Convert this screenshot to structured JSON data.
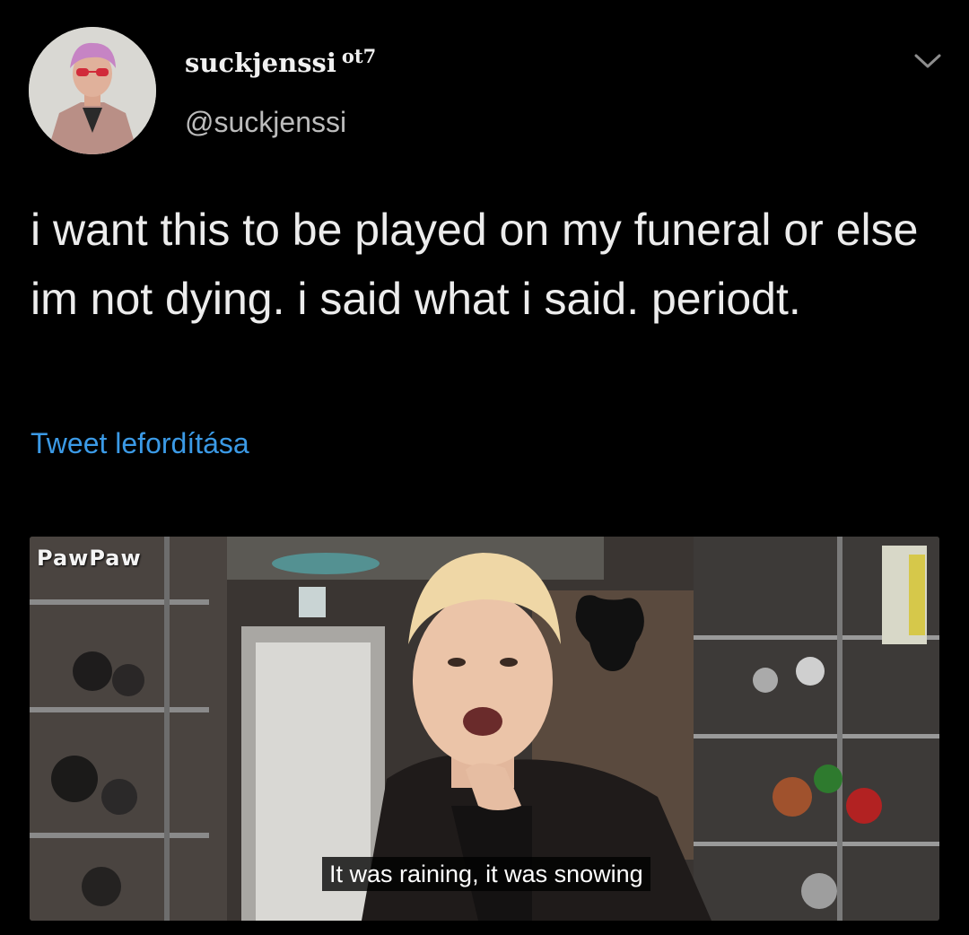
{
  "tweet": {
    "display_name": "suckjenssi",
    "name_suffix": "ot7",
    "handle": "@suckjenssi",
    "text": "i want this to be played on my funeral or else im not dying. i said what i said. periodt.",
    "translate_link": "Tweet lefordítása",
    "menu_icon": "chevron-down-icon",
    "link_color": "#3b9ae6",
    "background_color": "#000000"
  },
  "media": {
    "watermark": "PawPaw",
    "subtitle": "It was raining, it was snowing"
  }
}
